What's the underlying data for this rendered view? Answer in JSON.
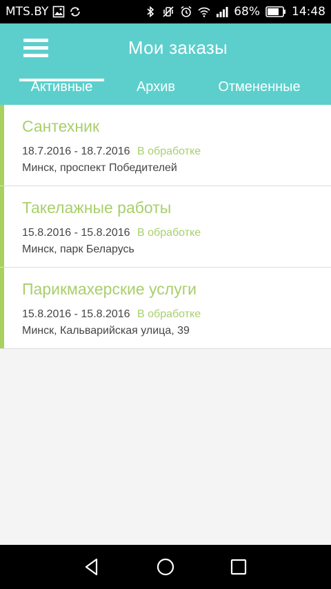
{
  "status_bar": {
    "carrier": "MTS.BY",
    "battery": "68%",
    "time": "14:48",
    "icons": [
      "gallery-icon",
      "sync-icon",
      "bluetooth-icon",
      "vibrate-icon",
      "alarm-icon",
      "wifi-icon",
      "signal-icon",
      "battery-icon"
    ]
  },
  "app_bar": {
    "title": "Мои заказы",
    "menu_icon": "hamburger-menu-icon",
    "background": "#5ccfcc"
  },
  "tabs": [
    {
      "label": "Активные",
      "selected": true
    },
    {
      "label": "Архив",
      "selected": false
    },
    {
      "label": "Отмененные",
      "selected": false
    }
  ],
  "orders": [
    {
      "title": "Сантехник",
      "dates": "18.7.2016 - 18.7.2016",
      "status": "В обработке",
      "location": "Минск, проспект Победителей"
    },
    {
      "title": "Такелажные работы",
      "dates": "15.8.2016 - 15.8.2016",
      "status": "В обработке",
      "location": "Минск, парк Беларусь"
    },
    {
      "title": "Парикмахерские услуги",
      "dates": "15.8.2016 - 15.8.2016",
      "status": "В обработке",
      "location": "Минск, Кальварийская улица, 39"
    }
  ],
  "colors": {
    "accent_green": "#a8cf6a",
    "teal": "#5ccfcc"
  },
  "nav_bar": {
    "icons": [
      "back-icon",
      "home-icon",
      "recent-apps-icon"
    ]
  }
}
